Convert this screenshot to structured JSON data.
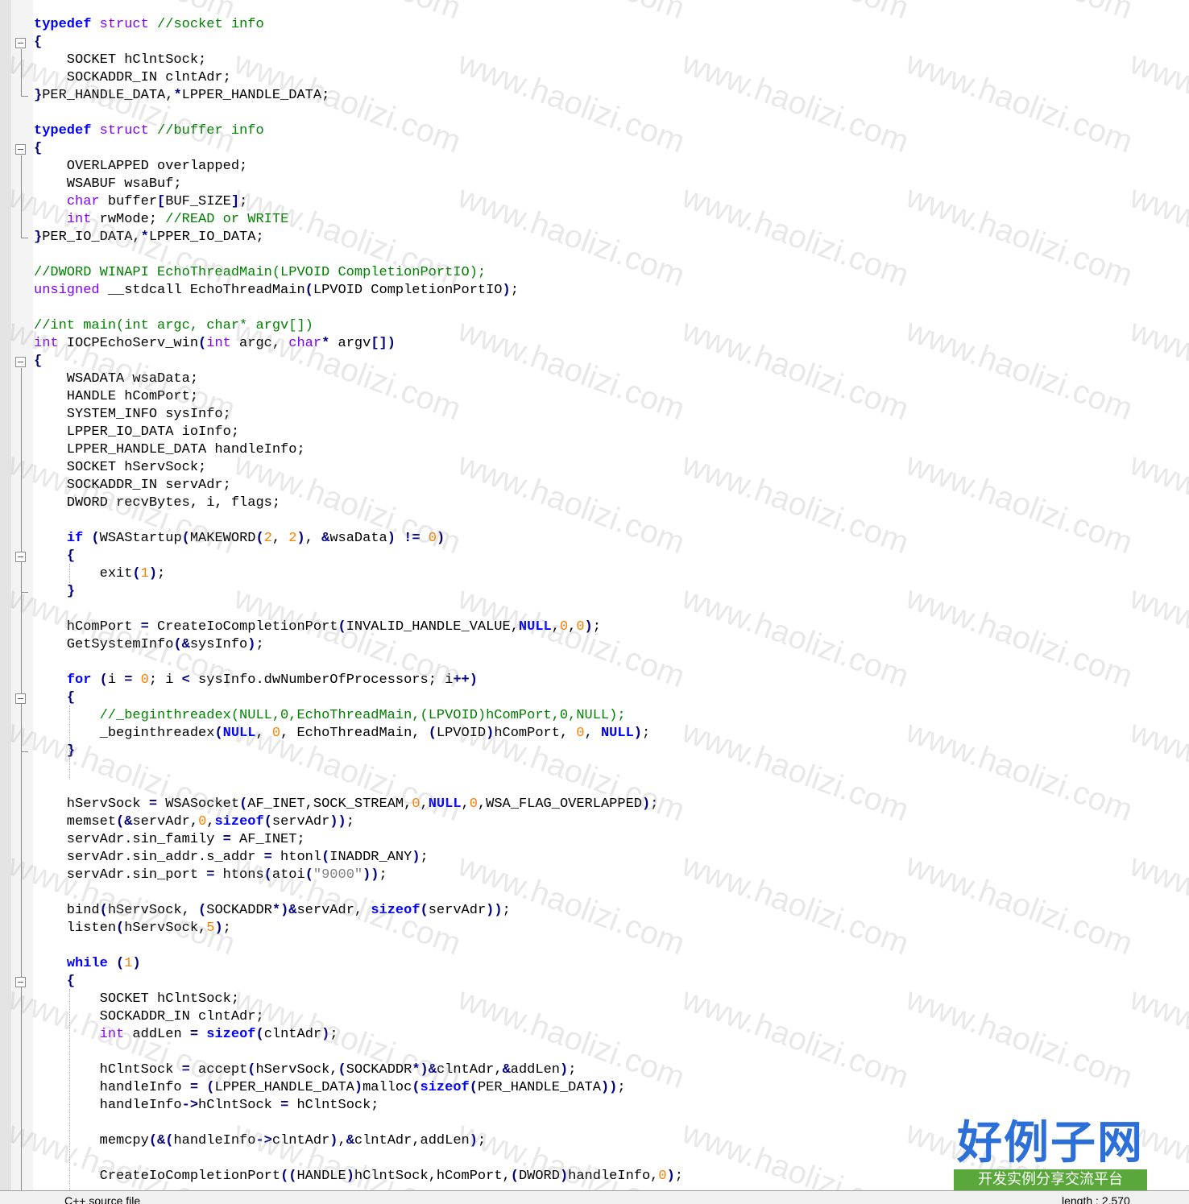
{
  "editor": {
    "lines": [
      "[[kw:typedef]] [[ty:struct]] [[cm://socket info]]",
      "[[op:{]]",
      "    SOCKET hClntSock;",
      "    SOCKADDR_IN clntAdr;",
      "[[op:}]]PER_HANDLE_DATA,[[op:*]]LPPER_HANDLE_DATA;",
      "",
      "[[kw:typedef]] [[ty:struct]] [[cm://buffer info]]",
      "[[op:{]]",
      "    OVERLAPPED overlapped;",
      "    WSABUF wsaBuf;",
      "    [[ty:char]] buffer[[op:[]]BUF_SIZE[[op:]]];",
      "    [[ty:int]] rwMode; [[cm://READ or WRITE]]",
      "[[op:}]]PER_IO_DATA,[[op:*]]LPPER_IO_DATA;",
      "",
      "[[cm://DWORD WINAPI EchoThreadMain(LPVOID CompletionPortIO);]]",
      "[[ty:unsigned]] __stdcall EchoThreadMain[[op:(]]LPVOID CompletionPortIO[[op:)]];",
      "",
      "[[cm://int main(int argc, char* argv[])]]",
      "[[ty:int]] IOCPEchoServ_win[[op:(]][[ty:int]] argc, [[ty:char]][[op:*]] argv[[op:[])]]",
      "[[op:{]]",
      "    WSADATA wsaData;",
      "    HANDLE hComPort;",
      "    SYSTEM_INFO sysInfo;",
      "    LPPER_IO_DATA ioInfo;",
      "    LPPER_HANDLE_DATA handleInfo;",
      "    SOCKET hServSock;",
      "    SOCKADDR_IN servAdr;",
      "    DWORD recvBytes, i, flags;",
      "",
      "    [[kw:if]] [[op:(]]WSAStartup[[op:(]]MAKEWORD[[op:(]][[num:2]], [[num:2]][[op:)]], [[op:&]]wsaData[[op:)]] [[op:!=]] [[num:0]][[op:)]]",
      "    [[op:{]]",
      "        exit[[op:(]][[num:1]][[op:)]];",
      "    [[op:}]]",
      "",
      "    hComPort [[op:=]] CreateIoCompletionPort[[op:(]]INVALID_HANDLE_VALUE,[[kw:NULL]],[[num:0]],[[num:0]][[op:)]];",
      "    GetSystemInfo[[op:(&]]sysInfo[[op:)]];",
      "",
      "    [[kw:for]] [[op:(]]i [[op:=]] [[num:0]]; i [[op:<]] sysInfo.dwNumberOfProcessors; i[[op:++)]]",
      "    [[op:{]]",
      "        [[cm://_beginthreadex(NULL,0,EchoThreadMain,(LPVOID)hComPort,0,NULL);]]",
      "        _beginthreadex[[op:(]][[kw:NULL]], [[num:0]], EchoThreadMain, [[op:(]]LPVOID[[op:)]]hComPort, [[num:0]], [[kw:NULL]][[op:)]];",
      "    [[op:}]]",
      "",
      "",
      "    hServSock [[op:=]] WSASocket[[op:(]]AF_INET,SOCK_STREAM,[[num:0]],[[kw:NULL]],[[num:0]],WSA_FLAG_OVERLAPPED[[op:)]];",
      "    memset[[op:(&]]servAdr,[[num:0]],[[kw:sizeof]][[op:(]]servAdr[[op:))]];",
      "    servAdr.sin_family [[op:=]] AF_INET;",
      "    servAdr.sin_addr.s_addr [[op:=]] htonl[[op:(]]INADDR_ANY[[op:)]];",
      "    servAdr.sin_port [[op:=]] htons[[op:(]]atoi[[op:(]][[str:\"9000\"]][[op:))]];",
      "",
      "    bind[[op:(]]hServSock, [[op:(]]SOCKADDR[[op:*)&]]servAdr, [[kw:sizeof]][[op:(]]servAdr[[op:))]];",
      "    listen[[op:(]]hServSock,[[num:5]][[op:)]];",
      "",
      "    [[kw:while]] [[op:(]][[num:1]][[op:)]]",
      "    [[op:{]]",
      "        SOCKET hClntSock;",
      "        SOCKADDR_IN clntAdr;",
      "        [[ty:int]] addLen [[op:=]] [[kw:sizeof]][[op:(]]clntAdr[[op:)]];",
      "",
      "        hClntSock [[op:=]] accept[[op:(]]hServSock,[[op:(]]SOCKADDR[[op:*)&]]clntAdr,[[op:&]]addLen[[op:)]];",
      "        handleInfo [[op:=]] [[op:(]]LPPER_HANDLE_DATA[[op:)]]malloc[[op:(]][[kw:sizeof]][[op:(]]PER_HANDLE_DATA[[op:))]];",
      "        handleInfo[[op:->]]hClntSock [[op:=]] hClntSock;",
      "",
      "        memcpy[[op:(&(]]handleInfo[[op:->]]clntAdr[[op:)]],[[op:&]]clntAdr,addLen[[op:)]];",
      "",
      "        CreateIoCompletionPort[[op:((]]HANDLE[[op:)]]hClntSock,hComPort,[[op:(]]DWORD[[op:)]]handleInfo,[[num:0]][[op:)]];"
    ]
  },
  "watermark": {
    "text": "www.haolizi.com"
  },
  "logo": {
    "title": "好例子网",
    "subtitle": "开发实例分享交流平台"
  },
  "statusbar": {
    "left": "C++ source file",
    "right": "length : 2,570"
  }
}
